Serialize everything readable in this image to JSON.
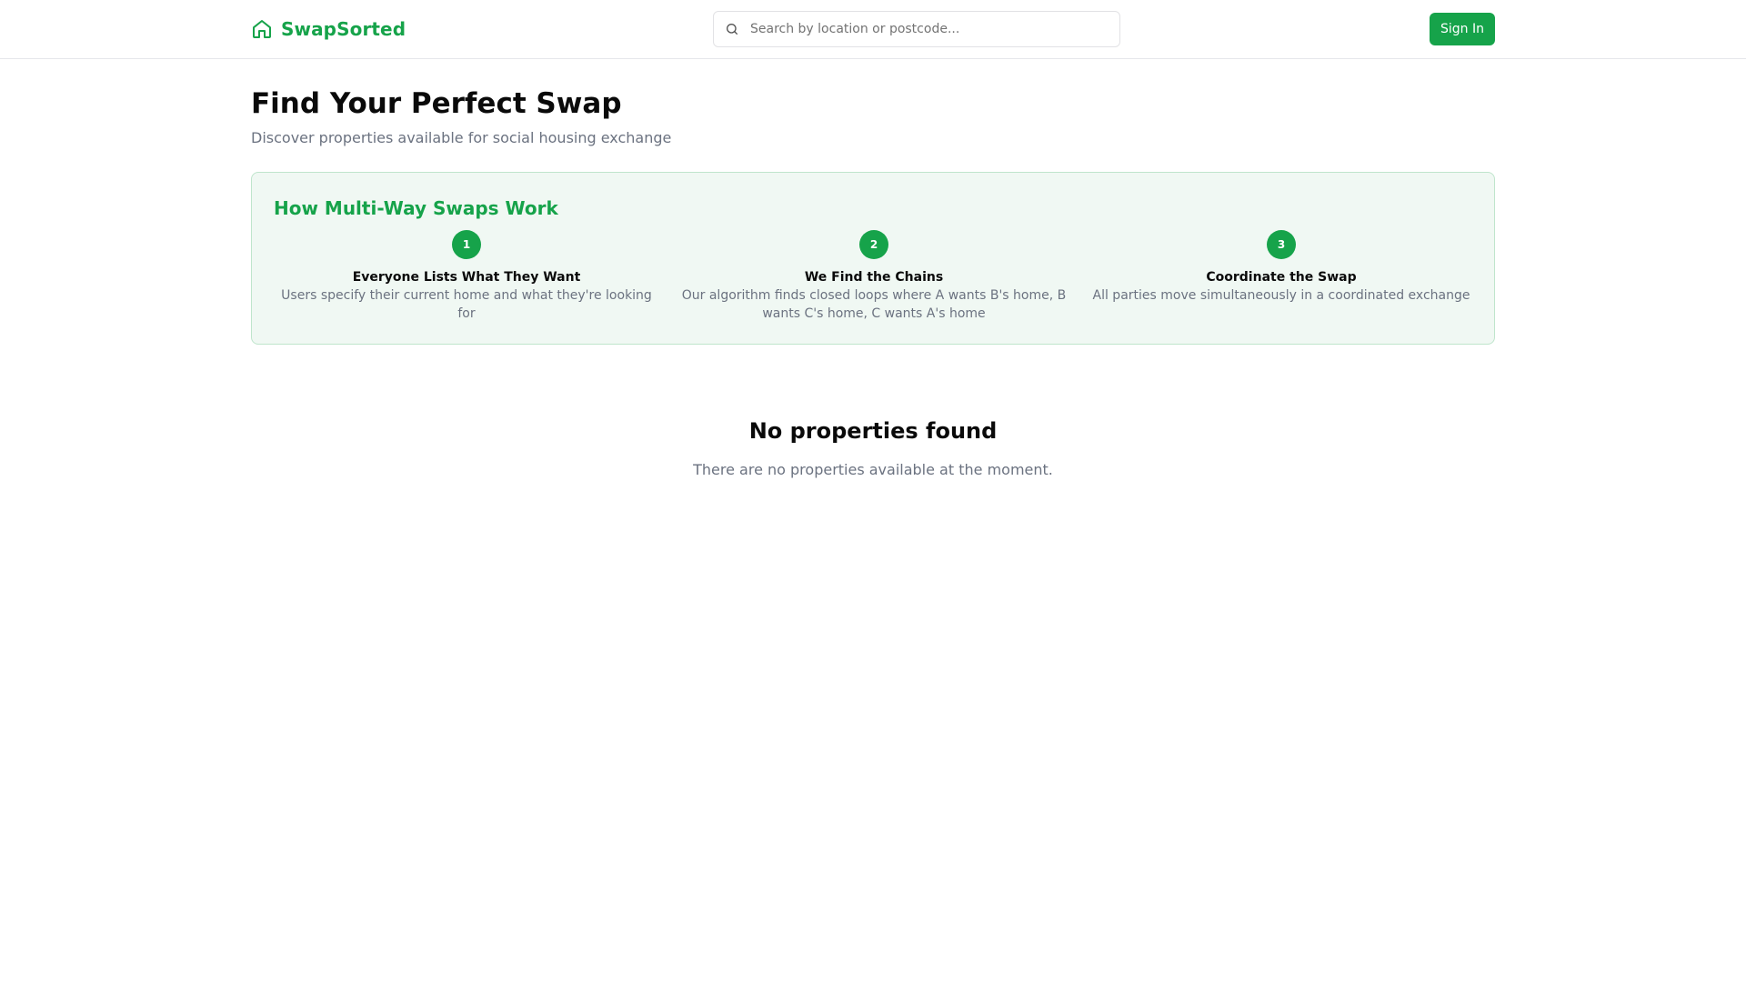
{
  "header": {
    "brand": "SwapSorted",
    "brand_icon": "home-icon",
    "search_placeholder": "Search by location or postcode...",
    "search_value": "",
    "signin_label": "Sign In"
  },
  "main": {
    "title": "Find Your Perfect Swap",
    "subtitle": "Discover properties available for social housing exchange"
  },
  "how_it_works": {
    "title": "How Multi-Way Swaps Work",
    "steps": [
      {
        "number": "1",
        "title": "Everyone Lists What They Want",
        "description": "Users specify their current home and what they're looking for"
      },
      {
        "number": "2",
        "title": "We Find the Chains",
        "description": "Our algorithm finds closed loops where A wants B's home, B wants C's home, C wants A's home"
      },
      {
        "number": "3",
        "title": "Coordinate the Swap",
        "description": "All parties move simultaneously in a coordinated exchange"
      }
    ]
  },
  "empty_state": {
    "title": "No properties found",
    "description": "There are no properties available at the moment."
  },
  "colors": {
    "accent": "#16a34a",
    "card_background": "#f0f8f3",
    "card_border": "#bfe5cc",
    "muted_text": "#6b7280"
  }
}
